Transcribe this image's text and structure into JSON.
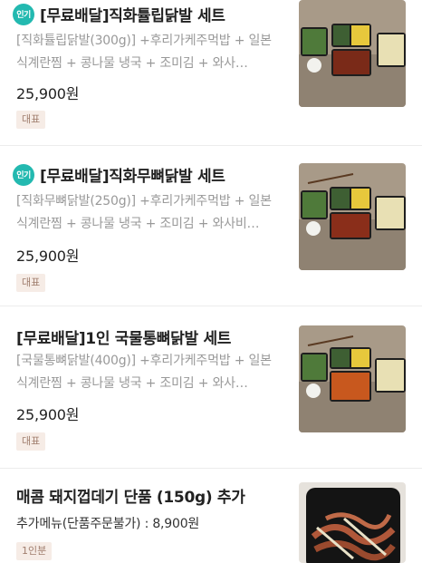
{
  "menu_items": [
    {
      "badge": "인기",
      "title": "[무료배달]직화튤립닭발 세트",
      "desc": "[직화튤립닭발(300g)] +후리가케주먹밥 + 일본식계란찜 + 콩나물 냉국 + 조미김  + 와사…",
      "price": "25,900원",
      "tag": "대표",
      "image_icon": "chicken-feet-set-photo"
    },
    {
      "badge": "인기",
      "title": "[무료배달]직화무뼈닭발 세트",
      "desc": "[직화무뼈닭발(250g)] +후리가케주먹밥 + 일본식계란찜 + 콩나물 냉국 + 조미김  + 와사비…",
      "price": "25,900원",
      "tag": "대표",
      "image_icon": "boneless-chicken-feet-set-photo"
    },
    {
      "badge": "",
      "title": "[무료배달]1인 국물통뼈닭발 세트",
      "desc": "[국물통뼈닭발(400g)] +후리가케주먹밥 + 일본식계란찜 + 콩나물 냉국 + 조미김  + 와사…",
      "price": "25,900원",
      "tag": "대표",
      "image_icon": "soup-chicken-feet-set-photo"
    },
    {
      "badge": "",
      "title": "매콤 돼지껍데기 단품 (150g) 추가",
      "desc": "추가메뉴(단품주문불가) : 8,900원",
      "price": "",
      "tag": "1인분",
      "image_icon": "pork-skin-photo"
    }
  ],
  "colors": {
    "badge": "#23b9b0",
    "tag_bg": "#f6ece6",
    "tag_text": "#a07e6e"
  }
}
